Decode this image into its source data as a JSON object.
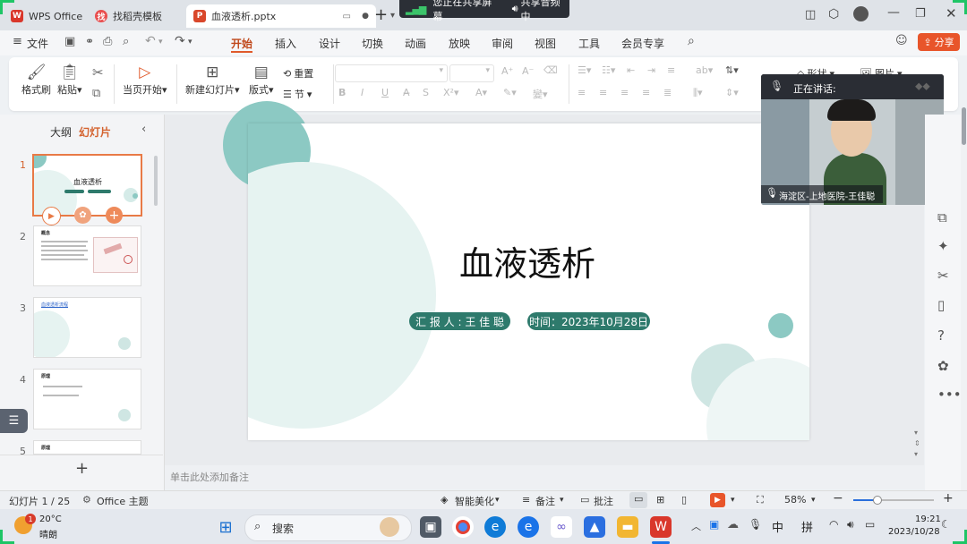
{
  "tabs": {
    "wps_home": "WPS Office",
    "templates": "找稻壳模板",
    "document": "血液透析.pptx"
  },
  "share_banner": {
    "screen_sharing": "您正在共享屏幕",
    "audio_sharing": "共享音频中"
  },
  "menubar": {
    "file": "文件",
    "items": [
      "开始",
      "插入",
      "设计",
      "切换",
      "动画",
      "放映",
      "审阅",
      "视图",
      "工具",
      "会员专享"
    ],
    "share": "分享"
  },
  "ribbon": {
    "format_painter": "格式刷",
    "paste": "粘贴",
    "play_from_current": "当页开始",
    "new_slide": "新建幻灯片",
    "layout": "版式",
    "reset": "重置",
    "section": "节",
    "shapes": "形状",
    "picture": "图片"
  },
  "left_panel": {
    "outline_tab": "大纲",
    "slides_tab": "幻灯片",
    "thumbs": [
      {
        "num": "1",
        "title": "血液透析"
      },
      {
        "num": "2",
        "title": "概念"
      },
      {
        "num": "3",
        "title": "血液透析流程"
      },
      {
        "num": "4",
        "title": "原理"
      },
      {
        "num": "5",
        "title": "原理"
      }
    ]
  },
  "slide": {
    "title": "血液透析",
    "reporter": "汇 报 人 :  王 佳 聪",
    "date": "时间：2023年10月28日"
  },
  "video_overlay": {
    "speaking_label": "正在讲话:",
    "participant": "海淀区-上地医院-王佳聪"
  },
  "notes_placeholder": "单击此处添加备注",
  "status": {
    "slide_counter": "幻灯片 1 / 25",
    "theme": "Office 主题",
    "beautify": "智能美化",
    "notes": "备注",
    "comments": "批注",
    "zoom": "58%"
  },
  "taskbar": {
    "temperature": "20°C",
    "weather": "晴朗",
    "weather_badge": "1",
    "search": "搜索",
    "ime_lang": "中",
    "ime_mode": "拼",
    "time": "19:21",
    "date": "2023/10/28"
  },
  "colors": {
    "accent_orange": "#e05a2b",
    "teal_dark": "#2e7a6c",
    "teal_circle": "#8cc9c3",
    "teal_light": "#e6f3f1",
    "wps_red": "#d9372b"
  }
}
